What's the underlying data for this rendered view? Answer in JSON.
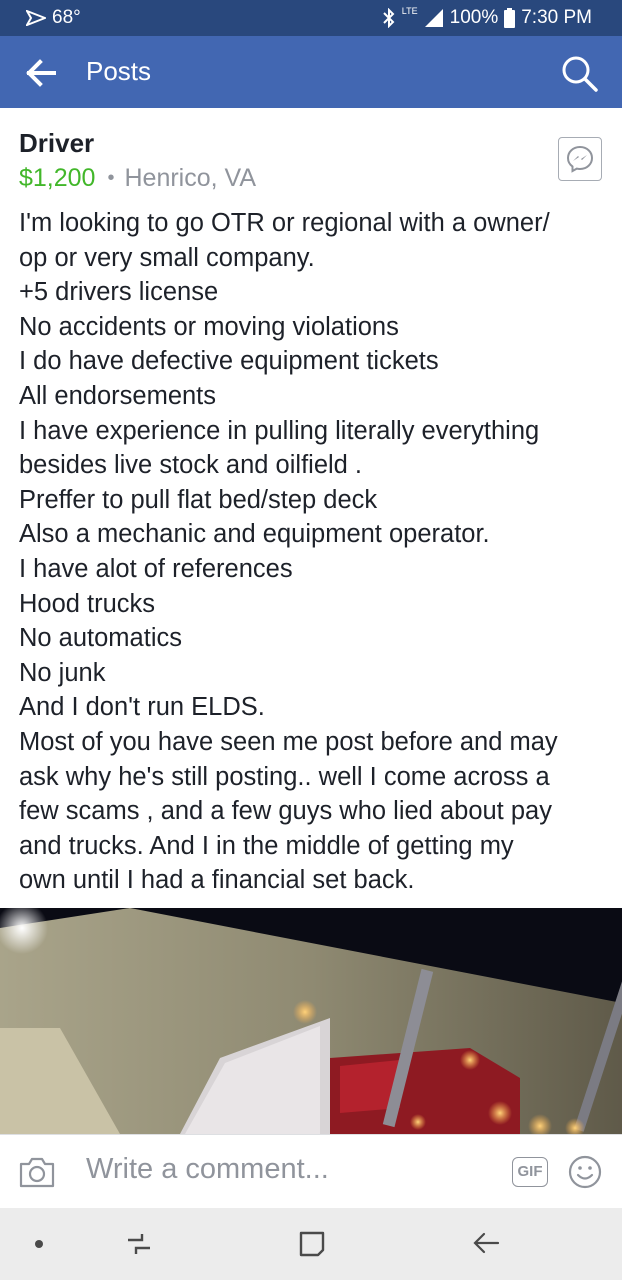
{
  "status_bar": {
    "weather": "68°",
    "network": "LTE",
    "battery": "100%",
    "time": "7:30 PM"
  },
  "header": {
    "title": "Posts",
    "back_icon": "arrow-left-icon",
    "search_icon": "search-icon"
  },
  "post": {
    "title": "Driver",
    "price": "$1,200",
    "separator": "•",
    "location": "Henrico, VA",
    "messenger_icon": "messenger-icon",
    "body_lines": [
      "I'm looking to go OTR or regional with a owner/",
      "op or very small company.",
      "+5 drivers license",
      "No accidents or moving violations",
      "I do have defective equipment tickets",
      "All endorsements",
      "I have experience in pulling literally everything",
      "besides live stock and oilfield .",
      "Preffer to pull flat bed/step deck",
      "Also a mechanic and equipment operator.",
      "I have alot of references",
      "Hood trucks",
      "No automatics",
      "No junk",
      "And I don't run ELDS.",
      "Most of you have seen me post before and may",
      "ask why he's still posting.. well I come across a",
      "few scams , and a few guys who lied about pay",
      "and trucks. And I in the middle of getting my",
      "own until I had a financial set back."
    ]
  },
  "comment_bar": {
    "placeholder": "Write a comment...",
    "gif_label": "GIF",
    "camera_icon": "camera-icon",
    "emoji_icon": "emoji-icon"
  },
  "nav_bar": {
    "icons": [
      "dot-icon",
      "recent-apps-icon",
      "home-icon",
      "back-icon"
    ]
  },
  "colors": {
    "status_bar": "#29487d",
    "header": "#4267b2",
    "price": "#42b72a",
    "secondary_text": "#90949c"
  }
}
